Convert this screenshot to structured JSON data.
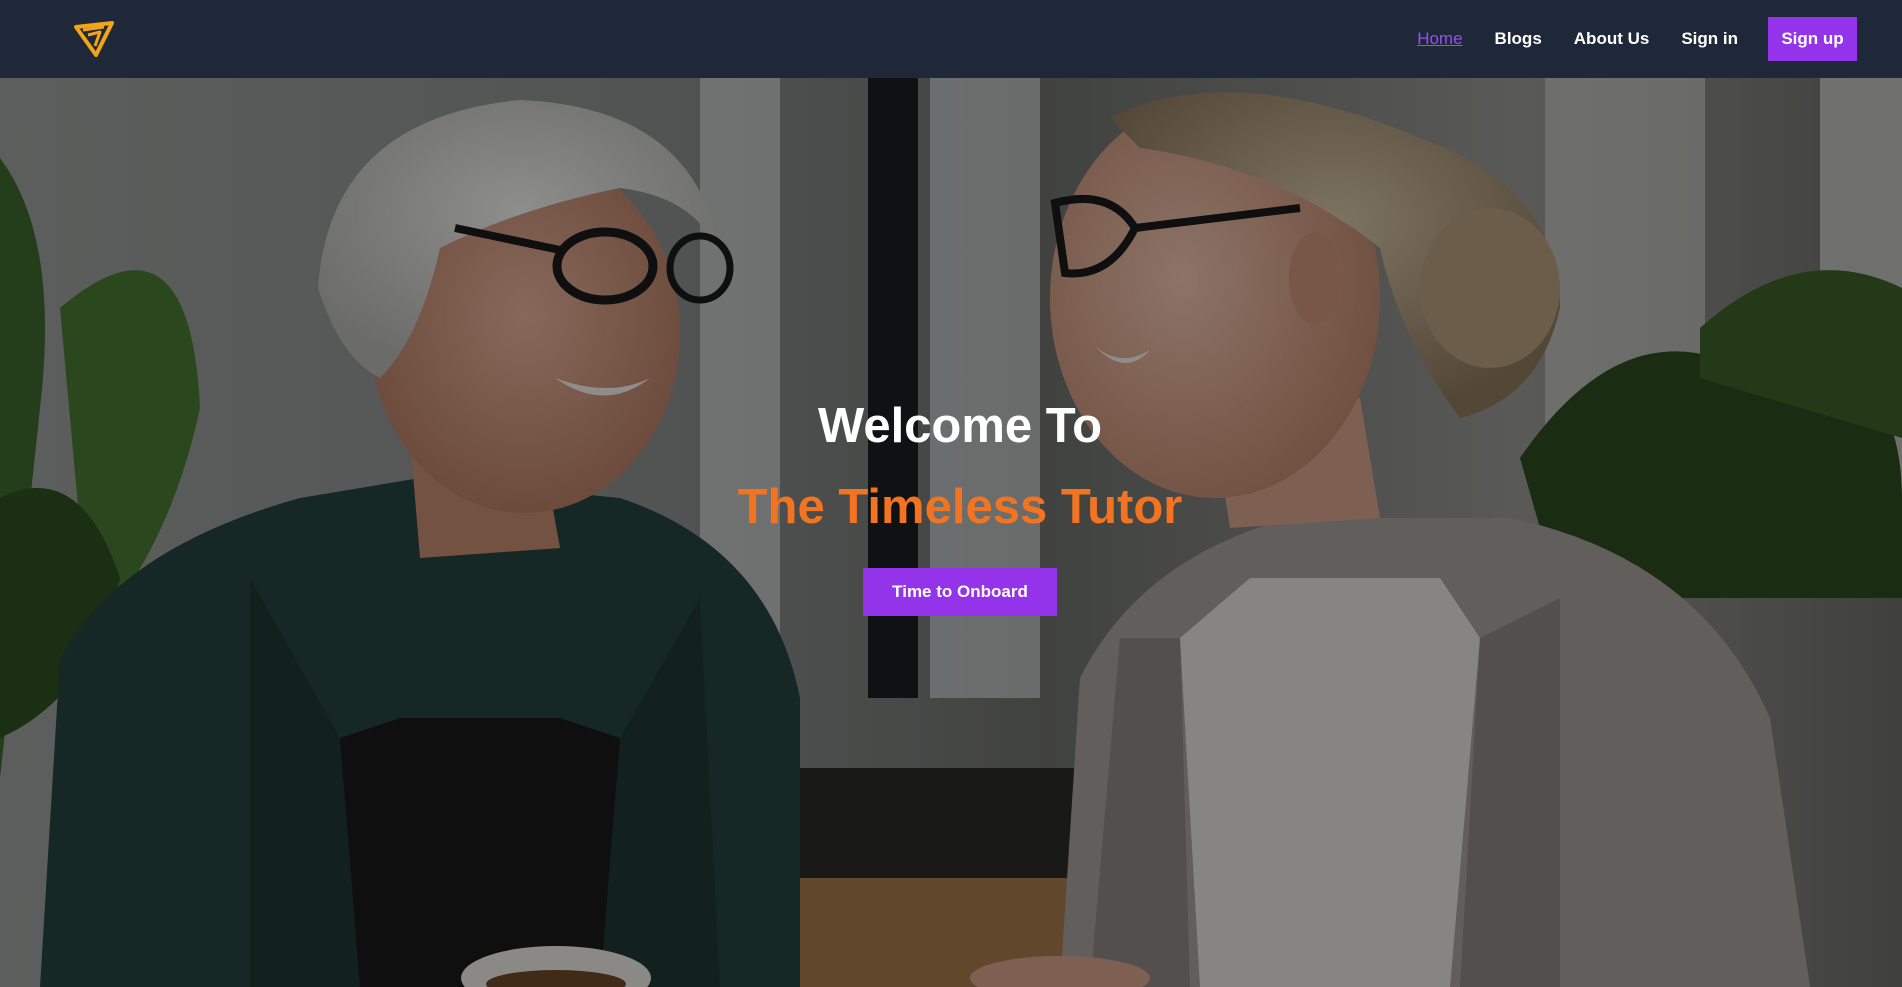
{
  "nav": {
    "logo_icon": "triangle-logo-icon",
    "items": [
      {
        "label": "Home",
        "active": true
      },
      {
        "label": "Blogs",
        "active": false
      },
      {
        "label": "About Us",
        "active": false
      },
      {
        "label": "Sign in",
        "active": false
      }
    ],
    "signup_label": "Sign up"
  },
  "hero": {
    "title": "Welcome To",
    "subtitle": "The Timeless Tutor",
    "cta_label": "Time to Onboard",
    "background_image": "two-women-laughing-office-photo"
  },
  "colors": {
    "navbar_bg": "#1f2839",
    "accent_purple": "#9333ea",
    "active_link": "#9b4df0",
    "subtitle_orange": "#f27420"
  }
}
